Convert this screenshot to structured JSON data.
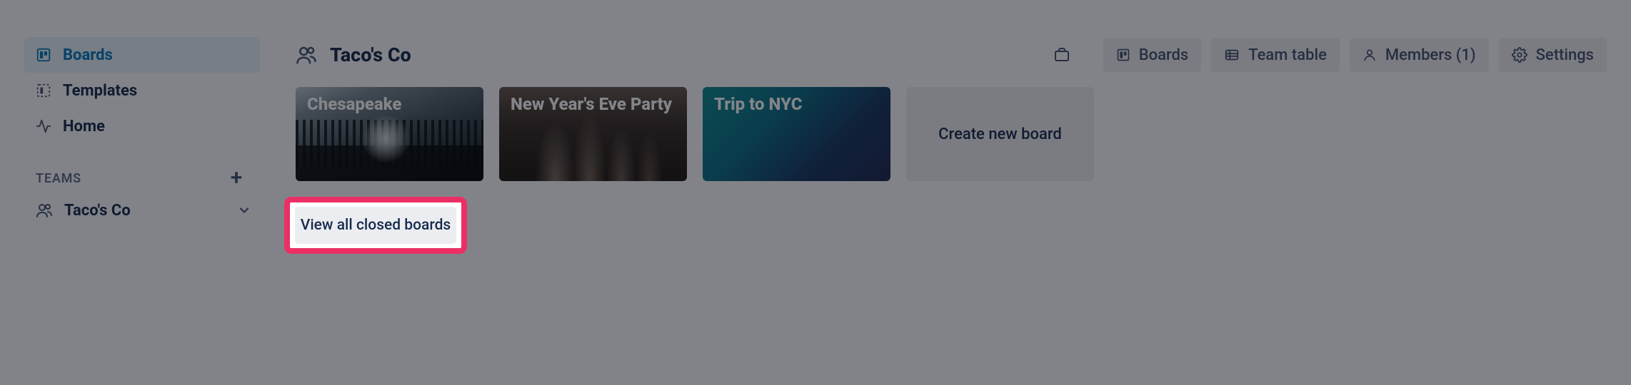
{
  "sidebar": {
    "nav": {
      "boards": "Boards",
      "templates": "Templates",
      "home": "Home"
    },
    "teams_heading": "TEAMS",
    "teams": [
      {
        "name": "Taco's Co"
      }
    ]
  },
  "main": {
    "team_name": "Taco's Co",
    "tabs": {
      "boards": "Boards",
      "team_table": "Team table",
      "members": "Members (1)",
      "settings": "Settings"
    },
    "boards": [
      {
        "title": "Chesapeake"
      },
      {
        "title": "New Year's Eve Party"
      },
      {
        "title": "Trip to NYC"
      }
    ],
    "create_board_label": "Create new board",
    "closed_boards_label": "View all closed boards"
  }
}
